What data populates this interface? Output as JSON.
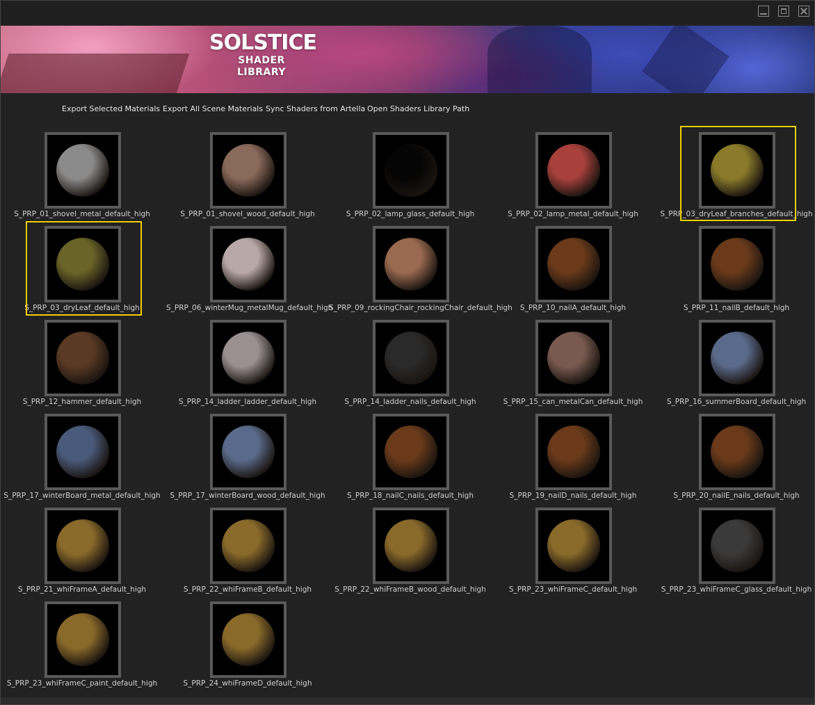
{
  "window": {
    "controls": {
      "minimize": "minimize-icon",
      "maximize": "maximize-icon",
      "close": "close-icon"
    }
  },
  "banner": {
    "logo_line1": "SOLSTICE",
    "logo_line2": "SHADER",
    "logo_line3": "LIBRARY"
  },
  "menu": [
    "Export Selected Materials",
    "Export All Scene Materials",
    "Sync Shaders from Artella",
    "Open Shaders Library Path"
  ],
  "materials": [
    {
      "name": "S_PRP_01_shovel_metal_default_high",
      "selected": false,
      "tone": "#8a8a8a"
    },
    {
      "name": "S_PRP_01_shovel_wood_default_high",
      "selected": false,
      "tone": "#8a6a5a"
    },
    {
      "name": "S_PRP_02_lamp_glass_default_high",
      "selected": false,
      "tone": "#050505"
    },
    {
      "name": "S_PRP_02_lamp_metal_default_high",
      "selected": false,
      "tone": "#a8403c"
    },
    {
      "name": "S_PRP_03_dryLeaf_branches_default_high",
      "selected": true,
      "tone": "#8a7a2a"
    },
    {
      "name": "S_PRP_03_dryLeaf_default_high",
      "selected": true,
      "tone": "#6a6428"
    },
    {
      "name": "S_PRP_06_winterMug_metalMug_default_high",
      "selected": false,
      "tone": "#b8a8a8"
    },
    {
      "name": "S_PRP_09_rockingChair_rockingChair_default_high",
      "selected": false,
      "tone": "#9a6a50"
    },
    {
      "name": "S_PRP_10_nailA_default_high",
      "selected": false,
      "tone": "#6a3a1a"
    },
    {
      "name": "S_PRP_11_nailB_default_high",
      "selected": false,
      "tone": "#6a3a1a"
    },
    {
      "name": "S_PRP_12_hammer_default_high",
      "selected": false,
      "tone": "#5a3a24"
    },
    {
      "name": "S_PRP_14_ladder_ladder_default_high",
      "selected": false,
      "tone": "#9a9090"
    },
    {
      "name": "S_PRP_14_ladder_nails_default_high",
      "selected": false,
      "tone": "#2a2a2a"
    },
    {
      "name": "S_PRP_15_can_metalCan_default_high",
      "selected": false,
      "tone": "#7a5a50"
    },
    {
      "name": "S_PRP_16_summerBoard_default_high",
      "selected": false,
      "tone": "#5a6a8a"
    },
    {
      "name": "S_PRP_17_winterBoard_metal_default_high",
      "selected": false,
      "tone": "#4a5a7a"
    },
    {
      "name": "S_PRP_17_winterBoard_wood_default_high",
      "selected": false,
      "tone": "#5a6a8a"
    },
    {
      "name": "S_PRP_18_nailC_nails_default_high",
      "selected": false,
      "tone": "#6a3a1a"
    },
    {
      "name": "S_PRP_19_nailD_nails_default_high",
      "selected": false,
      "tone": "#6a3a1a"
    },
    {
      "name": "S_PRP_20_nailE_nails_default_high",
      "selected": false,
      "tone": "#6a3a1a"
    },
    {
      "name": "S_PRP_21_whiFrameA_default_high",
      "selected": false,
      "tone": "#8a6a2a"
    },
    {
      "name": "S_PRP_22_whiFrameB_default_high",
      "selected": false,
      "tone": "#8a6a2a"
    },
    {
      "name": "S_PRP_22_whiFrameB_wood_default_high",
      "selected": false,
      "tone": "#8a6a2a"
    },
    {
      "name": "S_PRP_23_whiFrameC_default_high",
      "selected": false,
      "tone": "#8a6a2a"
    },
    {
      "name": "S_PRP_23_whiFrameC_glass_default_high",
      "selected": false,
      "tone": "#3a3a3a"
    },
    {
      "name": "S_PRP_23_whiFrameC_paint_default_high",
      "selected": false,
      "tone": "#8a6a2a"
    },
    {
      "name": "S_PRP_24_whiFrameD_default_high",
      "selected": false,
      "tone": "#8a6a2a"
    }
  ]
}
